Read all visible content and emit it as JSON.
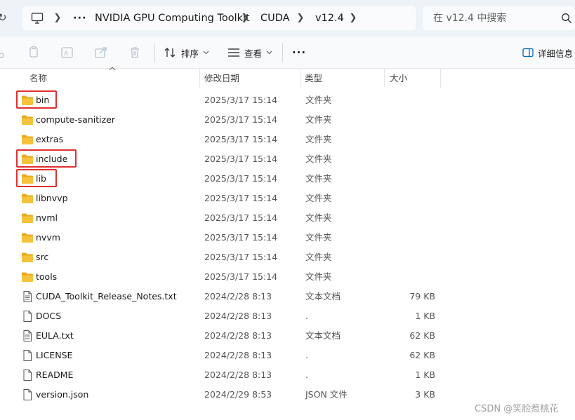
{
  "address": {
    "overflow": "···",
    "crumbs": [
      "NVIDIA GPU Computing Toolkit",
      "CUDA",
      "v12.4"
    ]
  },
  "search": {
    "placeholder": "在 v12.4 中搜索"
  },
  "toolbar": {
    "sort_label": "排序",
    "view_label": "查看",
    "more_label": "···",
    "details_label": "详细信息"
  },
  "columns": {
    "name": "名称",
    "date": "修改日期",
    "type": "类型",
    "size": "大小"
  },
  "files": [
    {
      "name": "bin",
      "date": "2025/3/17 15:14",
      "type": "文件夹",
      "size": "",
      "kind": "folder",
      "highlighted": true
    },
    {
      "name": "compute-sanitizer",
      "date": "2025/3/17 15:14",
      "type": "文件夹",
      "size": "",
      "kind": "folder",
      "highlighted": false
    },
    {
      "name": "extras",
      "date": "2025/3/17 15:14",
      "type": "文件夹",
      "size": "",
      "kind": "folder",
      "highlighted": false
    },
    {
      "name": "include",
      "date": "2025/3/17 15:14",
      "type": "文件夹",
      "size": "",
      "kind": "folder",
      "highlighted": true
    },
    {
      "name": "lib",
      "date": "2025/3/17 15:14",
      "type": "文件夹",
      "size": "",
      "kind": "folder",
      "highlighted": true
    },
    {
      "name": "libnvvp",
      "date": "2025/3/17 15:14",
      "type": "文件夹",
      "size": "",
      "kind": "folder",
      "highlighted": false
    },
    {
      "name": "nvml",
      "date": "2025/3/17 15:14",
      "type": "文件夹",
      "size": "",
      "kind": "folder",
      "highlighted": false
    },
    {
      "name": "nvvm",
      "date": "2025/3/17 15:14",
      "type": "文件夹",
      "size": "",
      "kind": "folder",
      "highlighted": false
    },
    {
      "name": "src",
      "date": "2025/3/17 15:14",
      "type": "文件夹",
      "size": "",
      "kind": "folder",
      "highlighted": false
    },
    {
      "name": "tools",
      "date": "2025/3/17 15:14",
      "type": "文件夹",
      "size": "",
      "kind": "folder",
      "highlighted": false
    },
    {
      "name": "CUDA_Toolkit_Release_Notes.txt",
      "date": "2024/2/28 8:13",
      "type": "文本文档",
      "size": "79 KB",
      "kind": "text-file",
      "highlighted": false
    },
    {
      "name": "DOCS",
      "date": "2024/2/28 8:13",
      "type": ".",
      "size": "1 KB",
      "kind": "file",
      "highlighted": false
    },
    {
      "name": "EULA.txt",
      "date": "2024/2/28 8:13",
      "type": "文本文档",
      "size": "62 KB",
      "kind": "text-file",
      "highlighted": false
    },
    {
      "name": "LICENSE",
      "date": "2024/2/28 8:13",
      "type": ".",
      "size": "62 KB",
      "kind": "file",
      "highlighted": false
    },
    {
      "name": "README",
      "date": "2024/2/28 8:13",
      "type": ".",
      "size": "1 KB",
      "kind": "file",
      "highlighted": false
    },
    {
      "name": "version.json",
      "date": "2024/2/29 8:53",
      "type": "JSON 文件",
      "size": "3 KB",
      "kind": "file",
      "highlighted": false
    }
  ],
  "colors": {
    "folder_yellow": "#f5c33b",
    "folder_back": "#e8a91c",
    "highlight_red": "#e03030",
    "accent_blue": "#0067c0"
  },
  "watermark": "CSDN @笑脸惹桃花"
}
